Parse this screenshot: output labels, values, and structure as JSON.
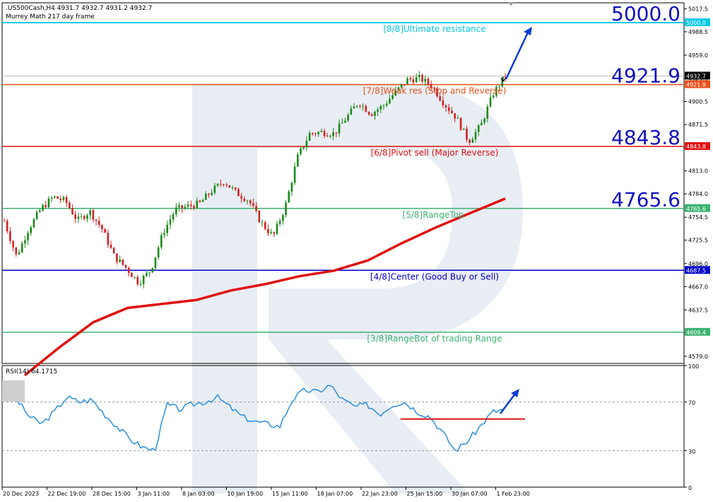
{
  "header": {
    "symbol_line": ".US500Cash,H4  4931.7 4932.7 4931.2 4932.7",
    "indicator_line": "Murrey Math 217 day frame",
    "collapse_arrow": "▼"
  },
  "colors": {
    "bull": "#1a8a1a",
    "bear": "#d62020",
    "ma": "#e01010",
    "rsi": "#2b8fe0",
    "cyan": "#00c8e8",
    "orange": "#e8501a",
    "red": "#e01010",
    "green": "#3cb371",
    "blue": "#0000cc",
    "arrow": "#0a3bd6"
  },
  "price_levels": [
    {
      "value": 5000.0,
      "big": "5000.0",
      "tag": "5000.0",
      "label": "[8/8]Ultimate resistance",
      "color": "#00c8e8",
      "text_color": "#00c8e8"
    },
    {
      "value": 4921.9,
      "big": "4921.9",
      "tag": "4921.9",
      "label": "[7/8]Weak res (Stop and Reverse)",
      "color": "#e8501a",
      "text_color": "#e8501a"
    },
    {
      "value": 4843.8,
      "big": "4843.8",
      "tag": "4843.8",
      "label": "[6/8]Pivot sell (Major Reverse)",
      "color": "#e01010",
      "text_color": "#e01010"
    },
    {
      "value": 4765.6,
      "big": "4765.6",
      "tag": "4765.6",
      "label": "[5/8]RangeTop",
      "color": "#3cb371",
      "text_color": "#3cb371"
    },
    {
      "value": 4687.5,
      "big": "",
      "tag": "4687.5",
      "label": "[4/8]Center (Good Buy or Sell)",
      "color": "#0000cc",
      "text_color": "#0000cc"
    },
    {
      "value": 4609.4,
      "big": "",
      "tag": "4609.4",
      "label": "[3/8]RangeBot of trading Range",
      "color": "#3cb371",
      "text_color": "#3cb371"
    }
  ],
  "current_price": {
    "value": 4932.7,
    "tag": "4932.7"
  },
  "price_axis_ticks": [
    "5017.5",
    "4988.5",
    "4959.0",
    "4929.5",
    "4900.5",
    "4871.5",
    "4842.0",
    "4813.0",
    "4784.0",
    "4754.5",
    "4725.5",
    "4696.0",
    "4667.0",
    "4637.5",
    "4608.5",
    "4579.0"
  ],
  "time_axis_labels": [
    "20 Dec 2023",
    "22 Dec 19:00",
    "28 Dec 15:00",
    "3 Jan 11:00",
    "8 Jan 03:00",
    "10 Jan 19:00",
    "15 Jan 11:00",
    "18 Jan 07:00",
    "22 Jan 23:00",
    "25 Jan 15:00",
    "30 Jan 07:00",
    "1 Feb 23:00"
  ],
  "rsi": {
    "title": "RSI(14) 64.1715",
    "ticks": [
      "100",
      "70",
      "30",
      "0"
    ],
    "levels": [
      70,
      30
    ],
    "support_level": 56
  },
  "chart_data": [
    {
      "type": "candlestick",
      "symbol": ".US500Cash",
      "timeframe": "H4",
      "x": [
        "20 Dec 2023",
        "22 Dec 19:00",
        "28 Dec 15:00",
        "3 Jan 11:00",
        "8 Jan 03:00",
        "10 Jan 19:00",
        "15 Jan 11:00",
        "18 Jan 07:00",
        "22 Jan 23:00",
        "25 Jan 15:00",
        "30 Jan 07:00",
        "1 Feb 23:00"
      ],
      "close_path": [
        4750,
        4705,
        4740,
        4765,
        4780,
        4775,
        4750,
        4762,
        4740,
        4705,
        4690,
        4672,
        4688,
        4735,
        4764,
        4768,
        4772,
        4788,
        4800,
        4785,
        4776,
        4748,
        4730,
        4768,
        4830,
        4860,
        4862,
        4860,
        4880,
        4900,
        4885,
        4895,
        4912,
        4928,
        4930,
        4920,
        4898,
        4880,
        4850,
        4870,
        4910,
        4932.7
      ],
      "ma_path": [
        4555,
        4590,
        4622,
        4640,
        4645,
        4650,
        4662,
        4670,
        4680,
        4687,
        4700,
        4722,
        4742,
        4760,
        4778
      ],
      "ylim": [
        4570,
        5025
      ],
      "hlines": [
        5000.0,
        4921.9,
        4843.8,
        4765.6,
        4687.5,
        4609.4
      ],
      "last_price": 4932.7
    },
    {
      "type": "line",
      "series": [
        {
          "name": "RSI(14)",
          "values": [
            78,
            72,
            58,
            52,
            62,
            74,
            70,
            72,
            60,
            50,
            40,
            33,
            30,
            68,
            64,
            68,
            70,
            74,
            66,
            58,
            54,
            52,
            50,
            72,
            80,
            78,
            84,
            72,
            66,
            68,
            60,
            68,
            70,
            62,
            58,
            45,
            30,
            38,
            50,
            62,
            64.17
          ]
        }
      ],
      "ylim": [
        0,
        100
      ],
      "levels": [
        70,
        30
      ]
    }
  ]
}
